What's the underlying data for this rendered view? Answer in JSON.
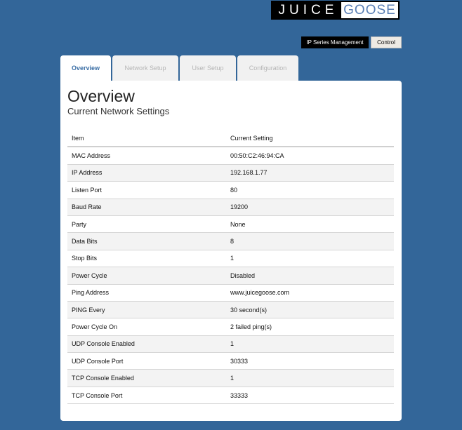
{
  "logo": {
    "left": "JUICE",
    "right": "GOOSE"
  },
  "topnav": {
    "ip_series": "IP Series Management",
    "control": "Control"
  },
  "tabs": [
    {
      "label": "Overview",
      "active": true
    },
    {
      "label": "Network Setup",
      "active": false
    },
    {
      "label": "User Setup",
      "active": false
    },
    {
      "label": "Configuration",
      "active": false
    }
  ],
  "panel": {
    "title": "Overview",
    "subtitle": "Current Network Settings"
  },
  "table": {
    "columns": [
      "Item",
      "Current Setting"
    ],
    "rows": [
      [
        "MAC Address",
        "00:50:C2:46:94:CA"
      ],
      [
        "IP Address",
        "192.168.1.77"
      ],
      [
        "Listen Port",
        "80"
      ],
      [
        "Baud Rate",
        "19200"
      ],
      [
        "Party",
        "None"
      ],
      [
        "Data Bits",
        "8"
      ],
      [
        "Stop Bits",
        "1"
      ],
      [
        "Power Cycle",
        "Disabled"
      ],
      [
        "Ping Address",
        "www.juicegoose.com"
      ],
      [
        "PING Every",
        "30 second(s)"
      ],
      [
        "Power Cycle On",
        "2 failed ping(s)"
      ],
      [
        "UDP Console Enabled",
        "1"
      ],
      [
        "UDP Console Port",
        "30333"
      ],
      [
        "TCP Console Enabled",
        "1"
      ],
      [
        "TCP Console Port",
        "33333"
      ]
    ]
  },
  "colors": {
    "background": "#336699",
    "active_tab_text": "#3a6ea5",
    "logo_goose": "#5a7fb5"
  }
}
